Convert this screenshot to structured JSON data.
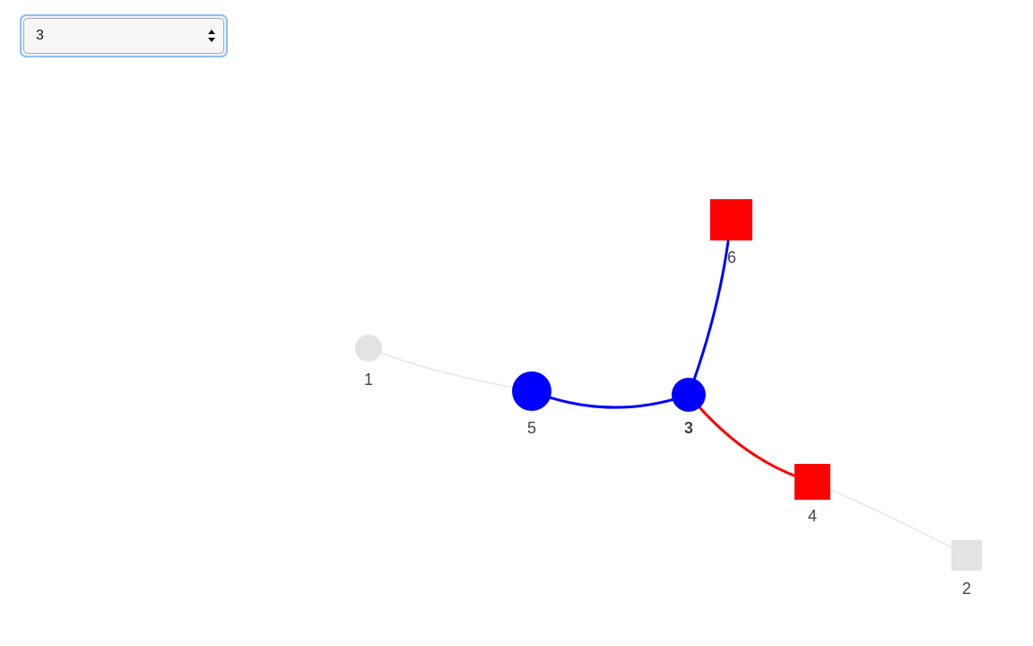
{
  "selector": {
    "selected_value": "3",
    "options": [
      "3"
    ]
  },
  "graph": {
    "selected_node": "3",
    "colors": {
      "blue": "#0000ff",
      "red": "#ff0000",
      "inactive": "#e3e3e3",
      "inactive_edge": "#e6e6e6",
      "label": "#444444"
    },
    "nodes": [
      {
        "id": "1",
        "label": "1",
        "shape": "circle",
        "state": "inactive"
      },
      {
        "id": "2",
        "label": "2",
        "shape": "square",
        "state": "inactive"
      },
      {
        "id": "3",
        "label": "3",
        "shape": "circle",
        "state": "selected-blue"
      },
      {
        "id": "4",
        "label": "4",
        "shape": "square",
        "state": "red"
      },
      {
        "id": "5",
        "label": "5",
        "shape": "circle",
        "state": "blue"
      },
      {
        "id": "6",
        "label": "6",
        "shape": "square",
        "state": "red"
      }
    ],
    "edges": [
      {
        "from": "1",
        "to": "5",
        "color": "inactive"
      },
      {
        "from": "5",
        "to": "3",
        "color": "blue"
      },
      {
        "from": "3",
        "to": "6",
        "color": "blue"
      },
      {
        "from": "3",
        "to": "4",
        "color": "red"
      },
      {
        "from": "4",
        "to": "2",
        "color": "inactive"
      }
    ]
  }
}
